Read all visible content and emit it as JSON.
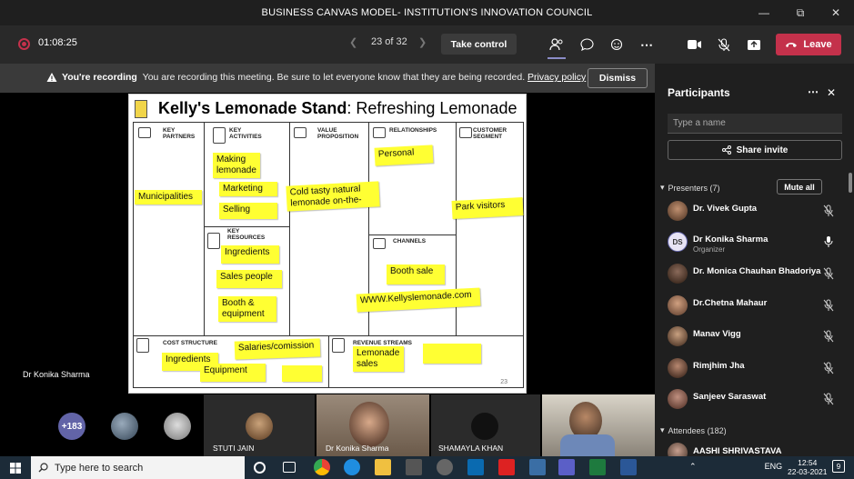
{
  "window": {
    "title": "BUSINESS CANVAS MODEL- INSTITUTION'S INNOVATION COUNCIL"
  },
  "toolbar": {
    "timer": "01:08:25",
    "page_indicator": "23 of 32",
    "take_control_label": "Take control",
    "leave_label": "Leave"
  },
  "recording_banner": {
    "heading": "You're recording",
    "message": "You are recording this meeting. Be sure to let everyone know that they are being recorded.",
    "link": "Privacy policy",
    "dismiss_label": "Dismiss"
  },
  "slide": {
    "title_bold": "Kelly's Lemonade Stand",
    "title_rest": ": Refreshing Lemonade",
    "page_number": "23",
    "sections": {
      "key_partners": "KEY PARTNERS",
      "key_activities": "KEY ACTIVITIES",
      "value_proposition": "VALUE PROPOSITION",
      "relationships": "RELATIONSHIPS",
      "customer_segment": "CUSTOMER SEGMENT",
      "key_resources": "KEY RESOURCES",
      "channels": "CHANNELS",
      "cost_structure": "COST STRUCTURE",
      "revenue_streams": "REVENUE STREAMS"
    },
    "notes": {
      "municipalities": "Municipalities",
      "making_lemonade": "Making lemonade",
      "marketing": "Marketing",
      "selling": "Selling",
      "value": "Cold tasty natural lemonade on-the-",
      "personal": "Personal",
      "park_visitors": "Park visitors",
      "ingredients_res": "Ingredients",
      "sales_people": "Sales people",
      "booth_equipment": "Booth & equipment",
      "booth_sale": "Booth sale",
      "website": "WWW.Kellyslemonade.com",
      "ingredients_cost": "Ingredients",
      "salaries": "Salaries/comission",
      "equipment": "Equipment",
      "lemonade_sales": "Lemonade sales"
    }
  },
  "presenter_label": "Dr Konika Sharma",
  "tiles": {
    "more_count": "+183",
    "stuti": "STUTI JAIN",
    "konika": "Dr Konika Sharma",
    "shamayla": "SHAMAYLA KHAN"
  },
  "participants_panel": {
    "title": "Participants",
    "search_placeholder": "Type a name",
    "share_invite_label": "Share invite",
    "presenters_heading": "Presenters (7)",
    "mute_all_label": "Mute all",
    "presenters": [
      {
        "name": "Dr. Vivek Gupta",
        "role": ""
      },
      {
        "name": "Dr Konika Sharma",
        "role": "Organizer",
        "initials": "DS"
      },
      {
        "name": "Dr. Monica Chauhan Bhadoriya",
        "role": ""
      },
      {
        "name": "Dr.Chetna Mahaur",
        "role": ""
      },
      {
        "name": "Manav Vigg",
        "role": ""
      },
      {
        "name": "Rimjhim Jha",
        "role": ""
      },
      {
        "name": "Sanjeev Saraswat",
        "role": ""
      }
    ],
    "attendees_heading": "Attendees (182)",
    "attendees_first": "AASHI SHRIVASTAVA"
  },
  "taskbar": {
    "search_placeholder": "Type here to search",
    "language": "ENG",
    "time": "12:54",
    "date": "22-03-2021",
    "notification_count": "9",
    "teams_badge": "9"
  },
  "colors": {
    "accent": "#6264a7",
    "leave": "#c4314b",
    "sticky": "#ffff33"
  }
}
